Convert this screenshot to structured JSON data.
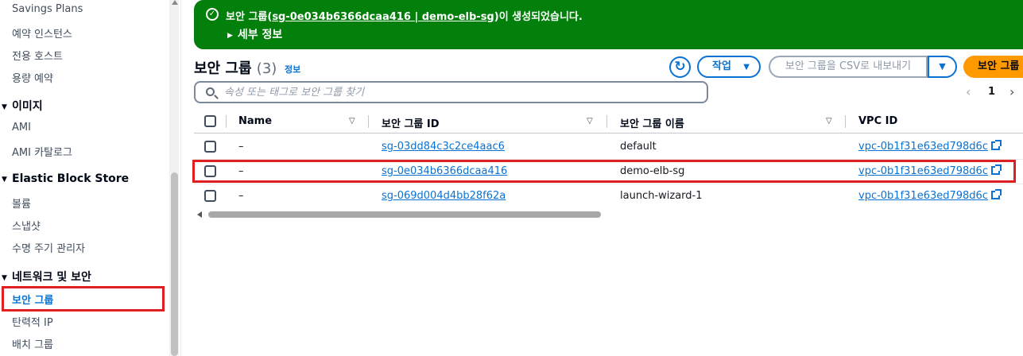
{
  "sidebar": {
    "links_top": [
      "Savings Plans",
      "예약 인스턴스",
      "전용 호스트",
      "용량 예약"
    ],
    "section_images": "이미지",
    "links_images": [
      "AMI",
      "AMI 카탈로그"
    ],
    "section_ebs": "Elastic Block Store",
    "links_ebs": [
      "볼륨",
      "스냅샷",
      "수명 주기 관리자"
    ],
    "section_network": "네트워크 및 보안",
    "links_network": [
      "보안 그룹",
      "탄력적 IP",
      "배치 그룹"
    ]
  },
  "flash": {
    "prefix": "보안 그룹(",
    "link": "sg-0e034b6366dcaa416 | demo-elb-sg",
    "suffix": ")이 생성되었습니다.",
    "details": "세부 정보"
  },
  "header": {
    "title": "보안 그룹",
    "count": "(3)",
    "info": "정보",
    "refresh_icon": "↻",
    "actions": "작업",
    "csv": "보안 그룹을 CSV로 내보내기",
    "create": "보안 그룹 생성"
  },
  "search": {
    "placeholder": "속성 또는 태그로 보안 그룹 찾기",
    "value": ""
  },
  "pagination": {
    "prev": "‹",
    "page": "1",
    "next": "›"
  },
  "table": {
    "columns": [
      "Name",
      "보안 그룹 ID",
      "보안 그룹 이름",
      "VPC ID"
    ],
    "rows": [
      {
        "name": "–",
        "id": "sg-03dd84c3c2ce4aac6",
        "group_name": "default",
        "vpc": "vpc-0b1f31e63ed798d6c"
      },
      {
        "name": "–",
        "id": "sg-0e034b6366dcaa416",
        "group_name": "demo-elb-sg",
        "vpc": "vpc-0b1f31e63ed798d6c"
      },
      {
        "name": "–",
        "id": "sg-069d004d4bb28f62a",
        "group_name": "launch-wizard-1",
        "vpc": "vpc-0b1f31e63ed798d6c"
      }
    ]
  },
  "colors": {
    "accent": "#0972d3",
    "success": "#037f0c",
    "primary_button": "#ff9900",
    "highlight": "#e02020"
  }
}
